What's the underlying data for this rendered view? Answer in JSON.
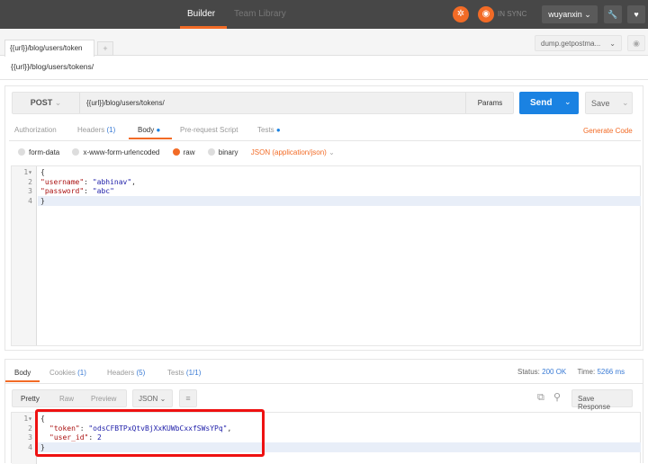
{
  "topbar": {
    "builder": "Builder",
    "team_library": "Team Library",
    "sync_status": "IN SYNC",
    "user": "wuyanxin"
  },
  "request_tabs": [
    {
      "label": "{{url}}/blog/users/token"
    }
  ],
  "new_tab": "+",
  "environment": "dump.getpostma...",
  "request_name": "{{url}}/blog/users/tokens/",
  "method": "POST",
  "url": "{{url}}/blog/users/tokens/",
  "params_label": "Params",
  "send_label": "Send",
  "save_label": "Save",
  "req_tabs": {
    "authorization": "Authorization",
    "headers": "Headers",
    "headers_count": "(1)",
    "body": "Body",
    "prerequest": "Pre-request Script",
    "tests": "Tests",
    "generate_code": "Generate Code"
  },
  "body_modes": {
    "form_data": "form-data",
    "urlencoded": "x-www-form-urlencoded",
    "raw": "raw",
    "binary": "binary",
    "content_type": "JSON (application/json)"
  },
  "request_body": {
    "l1": "{",
    "l2_key": "\"username\"",
    "l2_val": "\"abhinav\"",
    "l3_key": "\"password\"",
    "l3_val": "\"abc\"",
    "l4": "}"
  },
  "response": {
    "tabs": {
      "body": "Body",
      "cookies": "Cookies",
      "cookies_count": "(1)",
      "headers": "Headers",
      "headers_count": "(5)",
      "tests": "Tests",
      "tests_count": "(1/1)"
    },
    "status_label": "Status:",
    "status": "200 OK",
    "time_label": "Time:",
    "time": "5266 ms",
    "views": {
      "pretty": "Pretty",
      "raw": "Raw",
      "preview": "Preview",
      "format": "JSON"
    },
    "save_response": "Save Response",
    "body": {
      "l1": "{",
      "l2_key": "\"token\"",
      "l2_val": "\"odsCFBTPxQtvBjXxKUWbCxxfSWsYPq\"",
      "l3_key": "\"user_id\"",
      "l3_val": "2",
      "l4": "}"
    }
  },
  "colors": {
    "accent": "#f26b26",
    "send": "#1a82e2",
    "highlight": "#ee1111"
  }
}
